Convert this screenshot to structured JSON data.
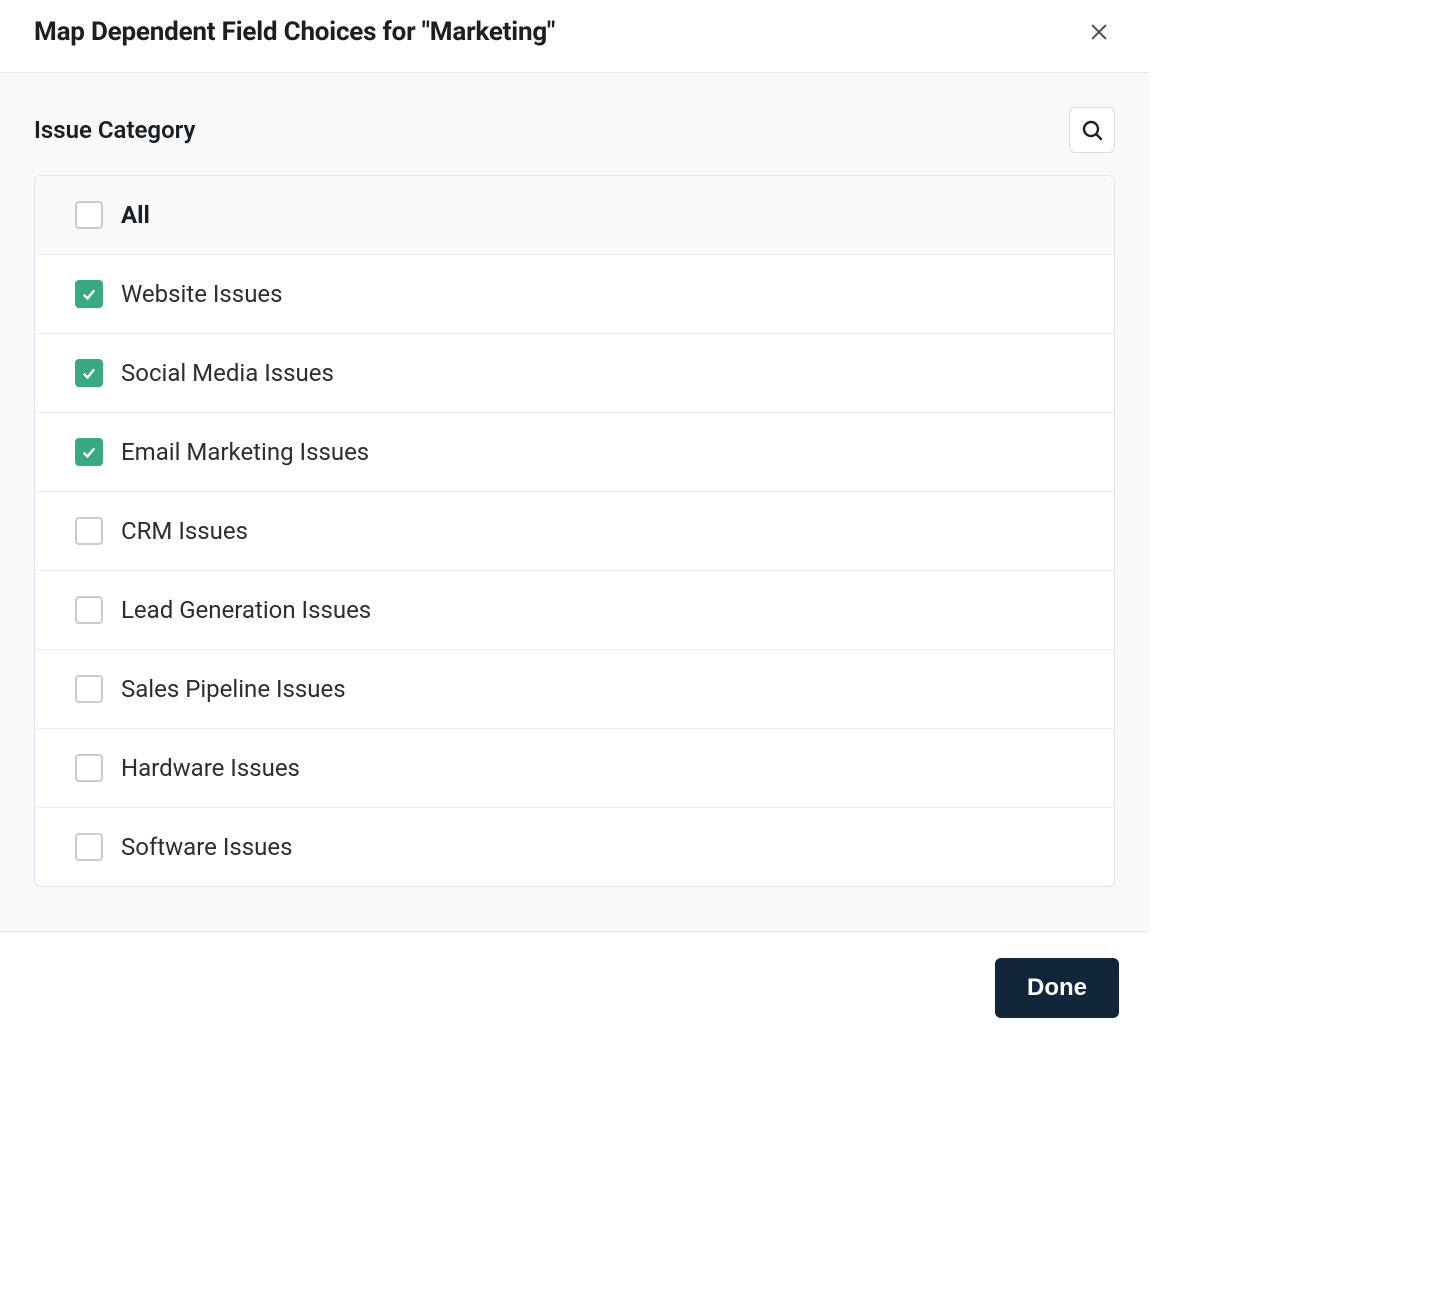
{
  "header": {
    "title": "Map Dependent Field Choices for \"Marketing\""
  },
  "section": {
    "title": "Issue Category"
  },
  "options": {
    "all_label": "All",
    "all_checked": false,
    "items": [
      {
        "label": "Website Issues",
        "checked": true
      },
      {
        "label": "Social Media Issues",
        "checked": true
      },
      {
        "label": "Email Marketing Issues",
        "checked": true
      },
      {
        "label": "CRM Issues",
        "checked": false
      },
      {
        "label": "Lead Generation Issues",
        "checked": false
      },
      {
        "label": "Sales Pipeline Issues",
        "checked": false
      },
      {
        "label": "Hardware Issues",
        "checked": false
      },
      {
        "label": "Software Issues",
        "checked": false
      }
    ]
  },
  "footer": {
    "done_label": "Done"
  },
  "colors": {
    "accent_check": "#3aa981",
    "primary_button": "#12263a"
  }
}
